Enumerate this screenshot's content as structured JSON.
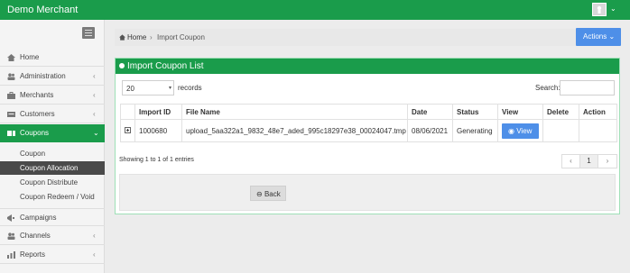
{
  "app": {
    "brand": "Demo Merchant"
  },
  "sidebar": {
    "items": [
      {
        "label": "Home",
        "icon": "home-icon",
        "arrow": ""
      },
      {
        "label": "Administration",
        "icon": "users-icon",
        "arrow": "‹"
      },
      {
        "label": "Merchants",
        "icon": "briefcase-icon",
        "arrow": "‹"
      },
      {
        "label": "Customers",
        "icon": "id-card-icon",
        "arrow": "‹"
      },
      {
        "label": "Coupons",
        "icon": "ticket-icon",
        "arrow": "⌄"
      },
      {
        "label": "Campaigns",
        "icon": "bullhorn-icon",
        "arrow": ""
      },
      {
        "label": "Channels",
        "icon": "channels-icon",
        "arrow": "‹"
      },
      {
        "label": "Reports",
        "icon": "chart-icon",
        "arrow": "‹"
      }
    ],
    "subitems": [
      "Coupon",
      "Coupon Allocation",
      "Coupon Distribute",
      "Coupon Redeem / Void"
    ]
  },
  "breadcrumb": {
    "home": "Home",
    "sep": "›",
    "current": "Import Coupon"
  },
  "actions": {
    "label": "Actions ⌄"
  },
  "panel": {
    "title": "Import Coupon List",
    "length_value": "20",
    "length_arrow": "▾",
    "records_label": "records",
    "search_label": "Search:",
    "search_value": ""
  },
  "table": {
    "headers": [
      "",
      "Import ID",
      "File Name",
      "Date",
      "Status",
      "View",
      "Delete",
      "Action"
    ],
    "rows": [
      {
        "import_id": "1000680",
        "file_name": "upload_5aa322a1_9832_48e7_aded_995c18297e38_00024047.tmp",
        "date": "08/06/2021",
        "status": "Generating",
        "view_label": "View"
      }
    ]
  },
  "footer": {
    "showing": "Showing 1 to 1 of 1 entries",
    "prev": "‹",
    "page": "1",
    "next": "›",
    "back_label": "Back"
  },
  "colors": {
    "brand_green": "#1a9c4b",
    "button_blue": "#4e8fe8"
  }
}
